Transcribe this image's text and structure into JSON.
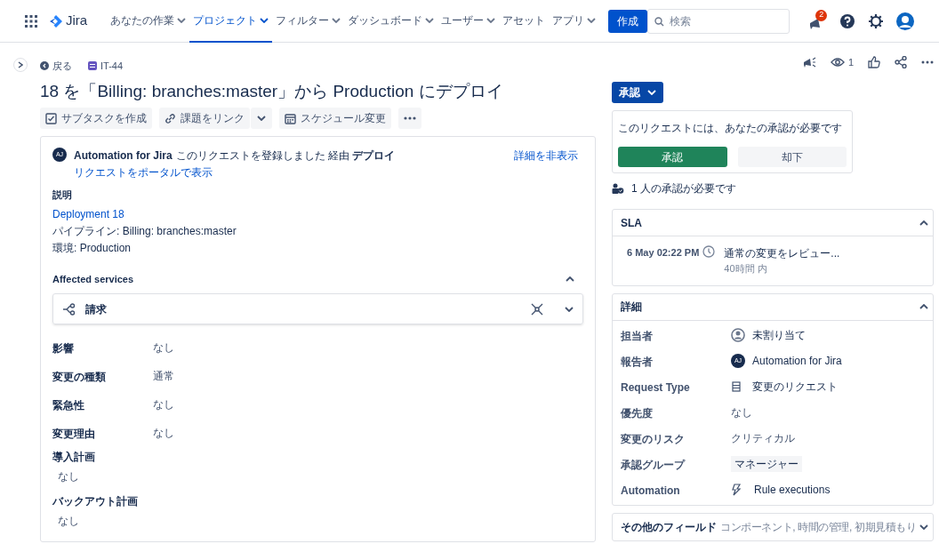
{
  "topnav": {
    "product": "Jira",
    "menu": [
      {
        "label": "あなたの作業",
        "dropdown": true,
        "selected": false
      },
      {
        "label": "プロジェクト",
        "dropdown": true,
        "selected": true
      },
      {
        "label": "フィルター",
        "dropdown": true,
        "selected": false
      },
      {
        "label": "ダッシュボード",
        "dropdown": true,
        "selected": false
      },
      {
        "label": "ユーザー",
        "dropdown": true,
        "selected": false
      },
      {
        "label": "アセット",
        "dropdown": false,
        "selected": false
      },
      {
        "label": "アプリ",
        "dropdown": true,
        "selected": false
      }
    ],
    "create_button": "作成",
    "search": {
      "placeholder": "検索"
    },
    "notification_count": "2"
  },
  "breadcrumb": {
    "back": "戻る",
    "issue_key": "IT-44"
  },
  "watchers": "1",
  "title": "18 を「Billing: branches:master」から Production にデプロイ",
  "actions": [
    {
      "kind": "subtask",
      "label": "サブタスクを作成"
    },
    {
      "kind": "link",
      "label": "課題をリンク"
    },
    {
      "kind": "schedule",
      "label": "スケジュール変更"
    }
  ],
  "activity": {
    "avatar": "AJ",
    "author": "Automation for Jira",
    "message": "このリクエストを登録しました 経由 **デプロイ**",
    "portal_link": "リクエストをポータルで表示",
    "hide_details": "詳細を非表示"
  },
  "description": {
    "label": "説明",
    "lines": [
      {
        "kind": "link",
        "text": "Deployment 18"
      },
      {
        "kind": "text",
        "text": "パイプライン: Billing: branches:master"
      },
      {
        "kind": "text",
        "text": "環境: Production"
      }
    ]
  },
  "affected_services": {
    "label": "Affected services",
    "expanded": true,
    "services": [
      {
        "name": "請求"
      }
    ]
  },
  "fields": [
    {
      "kind": "inline",
      "label": "影響",
      "value": "なし"
    },
    {
      "kind": "inline",
      "label": "変更の種類",
      "value": "通常"
    },
    {
      "kind": "inline",
      "label": "緊急性",
      "value": "なし"
    },
    {
      "kind": "inline",
      "label": "変更理由",
      "value": "なし"
    },
    {
      "kind": "stacked",
      "label": "導入計画",
      "value": "なし"
    },
    {
      "kind": "stacked",
      "label": "バックアウト計画",
      "value": "なし"
    }
  ],
  "status_button": "承認",
  "approval": {
    "message": "このリクエストには、あなたの承認が必要です",
    "approve": "承認",
    "decline": "却下",
    "note": "1 人の承認が必要です"
  },
  "sla": {
    "title": "SLA",
    "expanded": true,
    "items": [
      {
        "time": "6 May 02:22 PM",
        "goal": "通常の変更をレビュー...",
        "remaining": "40時間 内"
      }
    ]
  },
  "details": {
    "title": "詳細",
    "expanded": true,
    "rows": [
      {
        "kind": "unassigned",
        "label": "担当者",
        "value": "未割り当て"
      },
      {
        "kind": "avatar",
        "label": "報告者",
        "avatar": "AJ",
        "value": "Automation for Jira"
      },
      {
        "kind": "request_type",
        "label": "Request Type",
        "value": "変更のリクエスト"
      },
      {
        "kind": "text",
        "label": "優先度",
        "value": "なし"
      },
      {
        "kind": "text",
        "label": "変更のリスク",
        "value": "クリティカル"
      },
      {
        "kind": "lozenge",
        "label": "承認グループ",
        "value": "マネージャー"
      },
      {
        "kind": "automation",
        "label": "Automation",
        "value": "Rule executions"
      }
    ]
  },
  "other_fields": {
    "title": "その他のフィールド",
    "summary": "コンポーネント, 時間の管理, 初期見積もり",
    "expanded": false
  }
}
